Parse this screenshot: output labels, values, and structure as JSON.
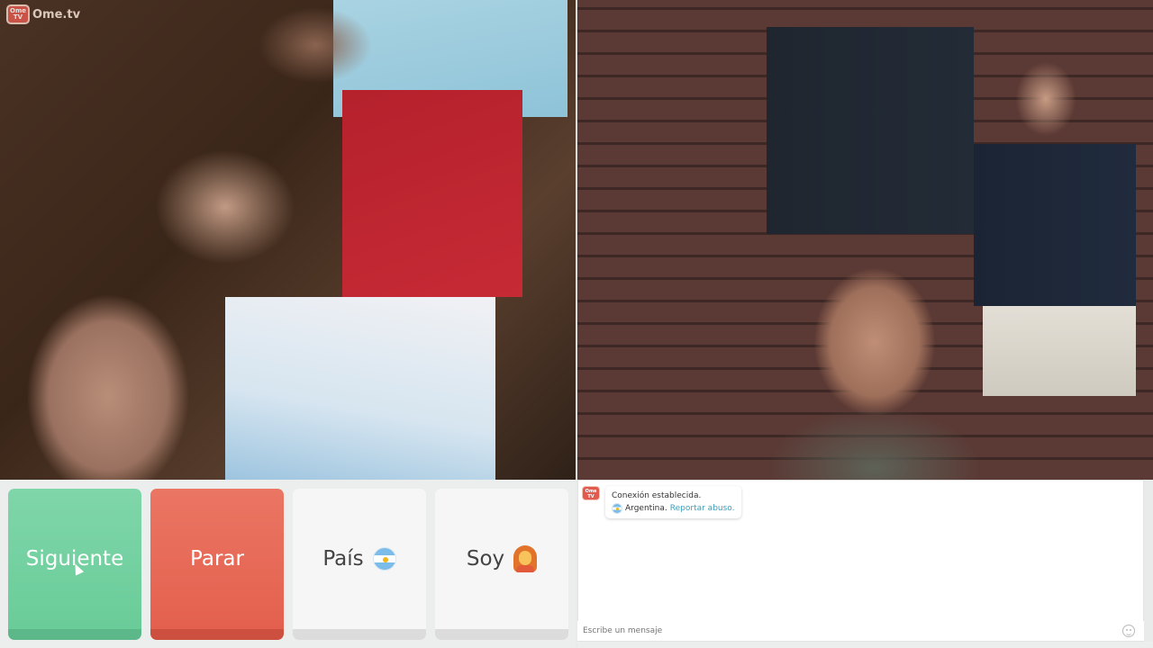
{
  "app": {
    "logo_text": "Ome.tv",
    "logo_icon_text": "Ome TV"
  },
  "controls": {
    "next_label": "Siguiente",
    "stop_label": "Parar",
    "country_label": "País",
    "country_flag": "argentina-flag-icon",
    "gender_label": "Soy",
    "gender_icon": "woman-emoji-icon"
  },
  "chat": {
    "status_message": "Conexión establecida.",
    "country_name": "Argentina.",
    "report_link": "Reportar abuso.",
    "input_placeholder": "Escribe un mensaje",
    "emoji_icon": "smiley-icon"
  },
  "colors": {
    "next": "#6acc99",
    "stop": "#e4604e",
    "link": "#3a9fb9",
    "brand": "#e05a4e"
  }
}
